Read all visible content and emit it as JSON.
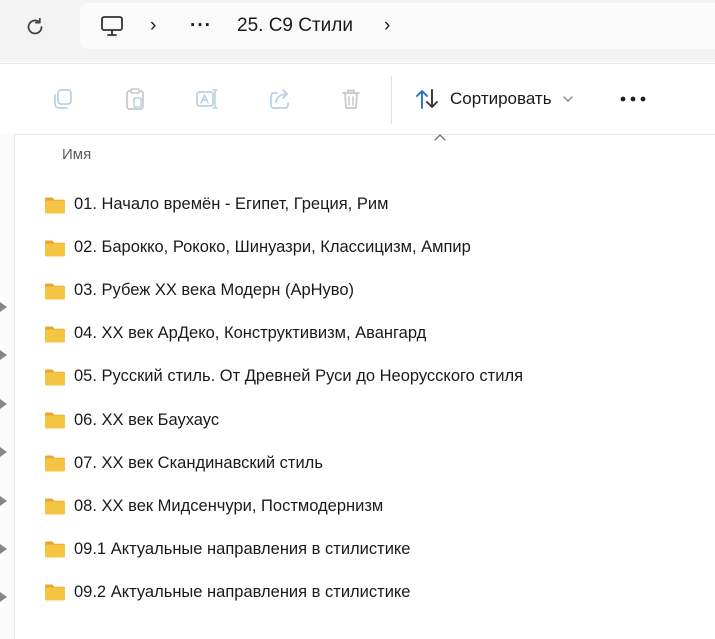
{
  "breadcrumb": {
    "separator": "›",
    "overflow": "···",
    "current_folder": "25. С9 Стили"
  },
  "toolbar": {
    "sort_label": "Сортировать",
    "more_label": "•••"
  },
  "columns": {
    "name_header": "Имя"
  },
  "files": [
    {
      "name": "01. Начало времён - Египет, Греция, Рим",
      "type": "folder"
    },
    {
      "name": "02. Барокко, Рококо, Шинуазри, Классицизм, Ампир",
      "type": "folder"
    },
    {
      "name": "03. Рубеж XX века Модерн (АрНуво)",
      "type": "folder"
    },
    {
      "name": "04. XX век АрДеко, Конструктивизм, Авангард",
      "type": "folder"
    },
    {
      "name": "05. Русский стиль. От Древней Руси до Неорусского стиля",
      "type": "folder"
    },
    {
      "name": "06. XX век Баухаус",
      "type": "folder"
    },
    {
      "name": "07. XX век Скандинавский стиль",
      "type": "folder"
    },
    {
      "name": "08. XX век Мидсенчури, Постмодернизм",
      "type": "folder"
    },
    {
      "name": "09.1 Актуальные направления в стилистике",
      "type": "folder"
    },
    {
      "name": "09.2 Актуальные направления в стилистике",
      "type": "folder"
    }
  ],
  "icons": {
    "refresh": "refresh-icon",
    "this_pc": "monitor-icon",
    "copy": "copy-icon",
    "paste": "paste-icon",
    "rename": "rename-icon",
    "share": "share-icon",
    "delete": "trash-icon",
    "sort": "sort-arrows-icon",
    "folder": "folder-icon"
  },
  "colors": {
    "folder_yellow": "#f6c443",
    "sort_blue": "#1f6fc5",
    "disabled_icon": "#b9cfe6"
  }
}
